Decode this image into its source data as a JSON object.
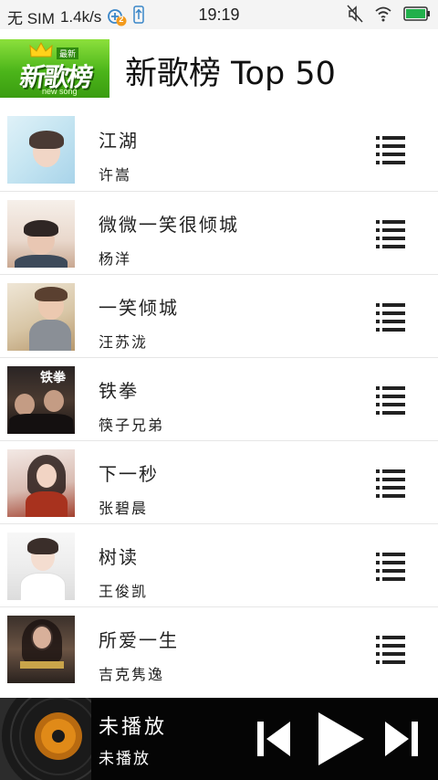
{
  "status_bar": {
    "carrier": "无 SIM",
    "speed": "1.4k/s",
    "badge_count": "2",
    "time": "19:19"
  },
  "header": {
    "logo_main": "新歌榜",
    "logo_tag": "最新",
    "logo_sub": "new song",
    "title": "新歌榜 Top 50"
  },
  "songs": [
    {
      "title": "江湖",
      "artist": "许嵩"
    },
    {
      "title": "微微一笑很倾城",
      "artist": "杨洋"
    },
    {
      "title": "一笑倾城",
      "artist": "汪苏泷"
    },
    {
      "title": "铁拳",
      "artist": "筷子兄弟"
    },
    {
      "title": "下一秒",
      "artist": "张碧晨"
    },
    {
      "title": "树读",
      "artist": "王俊凯"
    },
    {
      "title": "所爱一生",
      "artist": "吉克隽逸"
    }
  ],
  "player": {
    "title": "未播放",
    "artist": "未播放"
  },
  "colors": {
    "accent_green": "#4cb51a",
    "player_bg": "#050505",
    "battery_green": "#21b04b"
  },
  "icons": {
    "row_menu": "list-menu-icon",
    "prev": "skip-previous-icon",
    "play": "play-icon",
    "next": "skip-next-icon"
  }
}
